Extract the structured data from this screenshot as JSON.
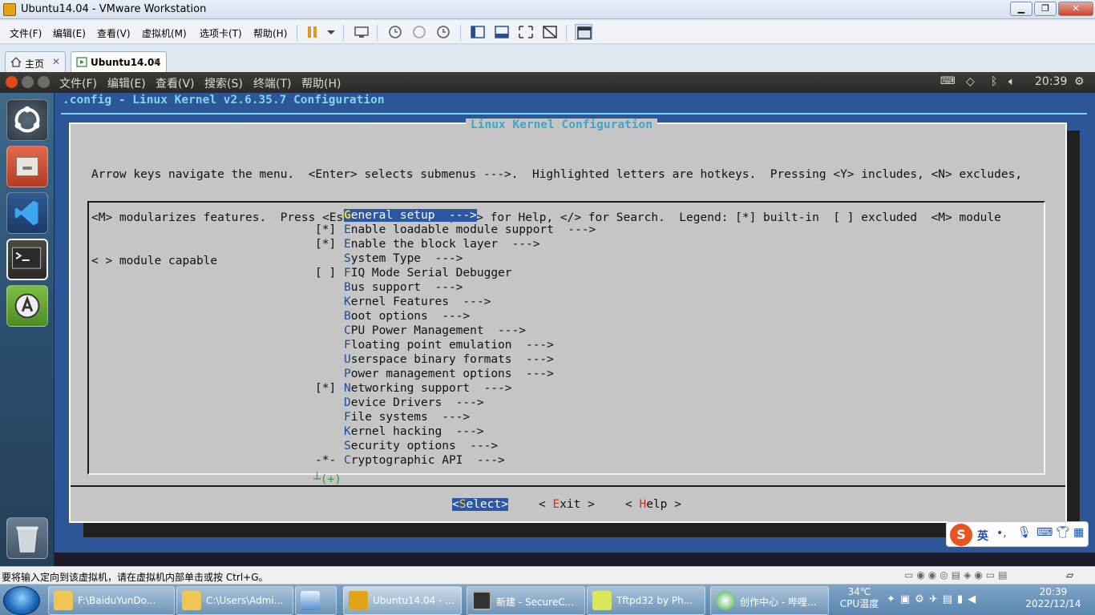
{
  "window": {
    "title": "Ubuntu14.04 - VMware Workstation"
  },
  "vmware_menu": [
    "文件(F)",
    "编辑(E)",
    "查看(V)",
    "虚拟机(M)",
    "选项卡(T)",
    "帮助(H)"
  ],
  "tabs": {
    "home": "主页",
    "vm": "Ubuntu14.04"
  },
  "ubuntu_menu": [
    "文件(F)",
    "编辑(E)",
    "查看(V)",
    "搜索(S)",
    "终端(T)",
    "帮助(H)"
  ],
  "ubuntu_clock": "20:39",
  "terminal": {
    "title": ".config - Linux Kernel v2.6.35.7 Configuration",
    "dialog_title": "Linux Kernel Configuration",
    "help_lines": [
      "Arrow keys navigate the menu.  <Enter> selects submenus --->.  Highlighted letters are hotkeys.  Pressing <Y> includes, <N> excludes,",
      "<M> modularizes features.  Press <Esc><Esc> to exit, <?> for Help, </> for Search.  Legend: [*] built-in  [ ] excluded  <M> module",
      "< > module capable"
    ],
    "menu_items": [
      {
        "mark": "",
        "hot": "G",
        "rest": "eneral setup  --->",
        "selected": true
      },
      {
        "mark": "[*]",
        "hot": "E",
        "rest": "nable loadable module support  --->"
      },
      {
        "mark": "[*]",
        "hot": "E",
        "rest": "nable the block layer  --->"
      },
      {
        "mark": "",
        "hot": "S",
        "rest": "ystem Type  --->"
      },
      {
        "mark": "[ ]",
        "hot": "F",
        "rest": "IQ Mode Serial Debugger"
      },
      {
        "mark": "",
        "hot": "B",
        "rest": "us support  --->"
      },
      {
        "mark": "",
        "hot": "K",
        "rest": "ernel Features  --->"
      },
      {
        "mark": "",
        "hot": "B",
        "rest": "oot options  --->"
      },
      {
        "mark": "",
        "hot": "C",
        "rest": "PU Power Management  --->"
      },
      {
        "mark": "",
        "hot": "F",
        "rest": "loating point emulation  --->"
      },
      {
        "mark": "",
        "hot": "U",
        "rest": "serspace binary formats  --->"
      },
      {
        "mark": "",
        "hot": "P",
        "rest": "ower management options  --->"
      },
      {
        "mark": "[*]",
        "hot": "N",
        "rest": "etworking support  --->"
      },
      {
        "mark": "",
        "hot": "D",
        "rest": "evice Drivers  --->"
      },
      {
        "mark": "",
        "hot": "F",
        "rest": "ile systems  --->"
      },
      {
        "mark": "",
        "hot": "K",
        "rest": "ernel hacking  --->"
      },
      {
        "mark": "",
        "hot": "S",
        "rest": "ecurity options  --->"
      },
      {
        "mark": "-*-",
        "hot": "C",
        "rest": "ryptographic API  --->"
      }
    ],
    "more_indicator": "┴(+)",
    "buttons": {
      "select_pre": "<",
      "select_hot": "S",
      "select_rest": "elect>",
      "exit_pre": "< ",
      "exit_hot": "E",
      "exit_rest": "xit >",
      "help_pre": "< ",
      "help_hot": "H",
      "help_rest": "elp >"
    }
  },
  "ime": {
    "label": "英"
  },
  "status_text": "要将输入定向到该虚拟机，请在虚拟机内部单击或按 Ctrl+G。",
  "taskbar": {
    "buttons": [
      "F:\\BaiduYunDo...",
      "C:\\Users\\Admi...",
      "",
      "Ubuntu14.04 - ...",
      "新建 - SecureC...",
      "Tftpd32 by Ph...",
      "创作中心 - 哔哩..."
    ],
    "temperature": "34℃",
    "temperature_label": "CPU温度",
    "time": "20:39",
    "date": "2022/12/14"
  }
}
